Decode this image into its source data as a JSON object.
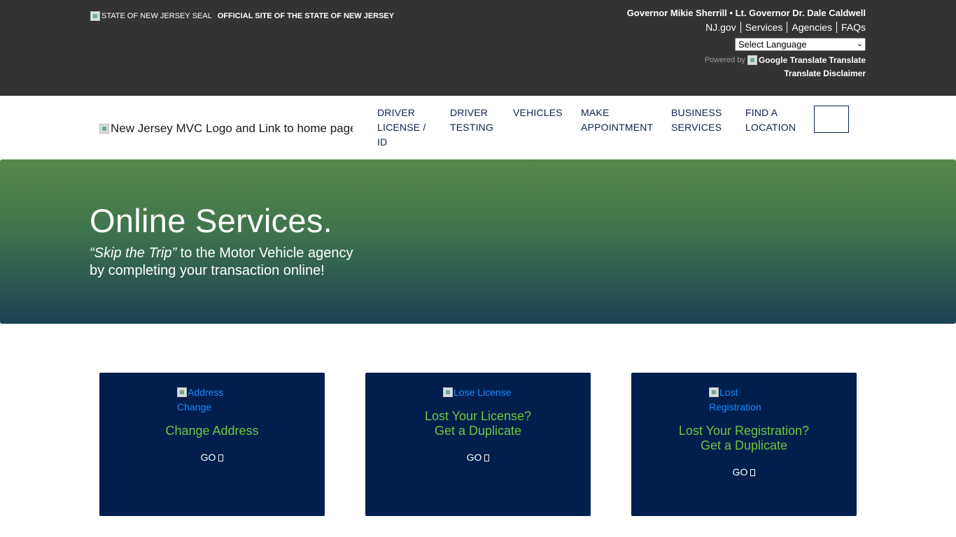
{
  "state_bar": {
    "seal_alt": "STATE OF NEW JERSEY SEAL",
    "official_text": "OFFICIAL SITE OF THE STATE OF NEW JERSEY",
    "governor_text": "Governor Mikie Sherrill • Lt. Governor Dr. Dale Caldwell",
    "links": [
      "NJ.gov",
      "Services",
      "Agencies",
      "FAQs"
    ],
    "language_select": "Select Language",
    "powered_by": "Powered by",
    "google_translate_alt": "Google Translate",
    "translate_label": "Translate",
    "disclaimer": "Translate Disclaimer"
  },
  "header": {
    "logo_alt": "New Jersey MVC Logo and Link to home page",
    "nav": [
      {
        "lines": [
          "DRIVER",
          "LICENSE /",
          "ID"
        ]
      },
      {
        "lines": [
          "DRIVER",
          "TESTING"
        ]
      },
      {
        "lines": [
          "VEHICLES"
        ]
      },
      {
        "lines": [
          "MAKE",
          "APPOINTMENT"
        ]
      },
      {
        "lines": [
          "BUSINESS",
          "SERVICES"
        ]
      },
      {
        "lines": [
          "FIND A",
          "LOCATION"
        ]
      }
    ]
  },
  "hero": {
    "title": "Online Services.",
    "subtitle_italic": "“Skip the Trip”",
    "subtitle_line1_rest": " to the Motor Vehicle agency",
    "subtitle_line2": "by completing your transaction online!"
  },
  "cards": [
    {
      "img_alt_1": "Address",
      "img_alt_2": "Change",
      "title_1": "Change Address",
      "title_2": "",
      "go": "GO"
    },
    {
      "img_alt_1": "Lose License",
      "img_alt_2": "",
      "title_1": "Lost Your License?",
      "title_2": "Get a Duplicate",
      "go": "GO"
    },
    {
      "img_alt_1": "Lost",
      "img_alt_2": "Registration",
      "title_1": "Lost Your Registration?",
      "title_2": "Get a Duplicate",
      "go": "GO"
    }
  ],
  "colors": {
    "state_bar_bg": "#333333",
    "nav_text": "#0b2149",
    "card_bg": "#001f4d",
    "card_title": "#72c341",
    "link_blue": "#1e88ff"
  }
}
